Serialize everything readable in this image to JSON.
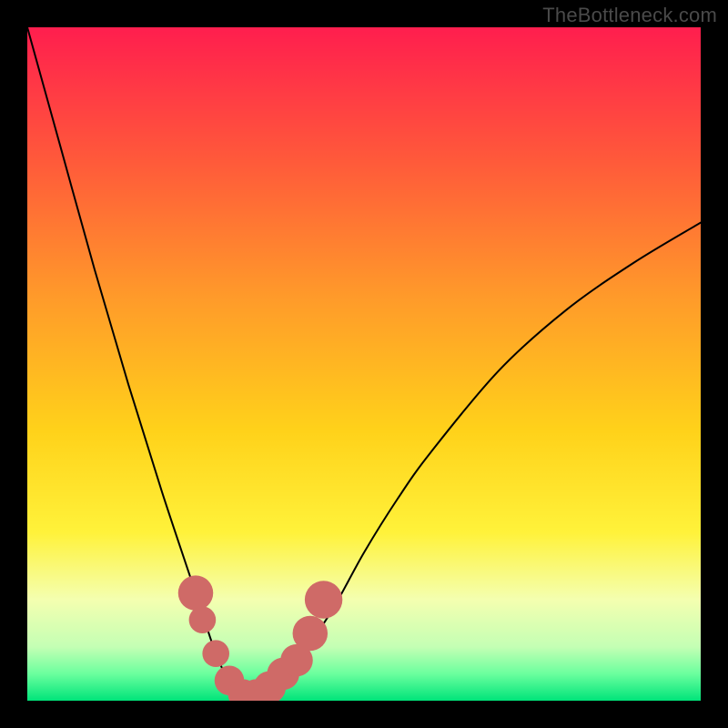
{
  "watermark": "TheBottleneck.com",
  "chart_data": {
    "type": "line",
    "title": "",
    "xlabel": "",
    "ylabel": "",
    "xlim": [
      0,
      100
    ],
    "ylim": [
      0,
      100
    ],
    "series": [
      {
        "name": "bottleneck-curve",
        "x": [
          0,
          5,
          10,
          15,
          20,
          25,
          28,
          30,
          32,
          34,
          36,
          40,
          45,
          50,
          55,
          60,
          70,
          80,
          90,
          100
        ],
        "values": [
          100,
          82,
          64,
          47,
          31,
          16,
          7,
          3,
          1,
          1,
          2,
          6,
          13,
          22,
          30,
          37,
          49,
          58,
          65,
          71
        ]
      }
    ],
    "background_gradient": {
      "stops": [
        {
          "offset": 0.0,
          "color": "#ff1e4e"
        },
        {
          "offset": 0.2,
          "color": "#ff5a3a"
        },
        {
          "offset": 0.4,
          "color": "#ff9a2a"
        },
        {
          "offset": 0.6,
          "color": "#ffd21a"
        },
        {
          "offset": 0.75,
          "color": "#fff23a"
        },
        {
          "offset": 0.85,
          "color": "#f4ffb0"
        },
        {
          "offset": 0.92,
          "color": "#c4ffb4"
        },
        {
          "offset": 0.96,
          "color": "#6bff9e"
        },
        {
          "offset": 1.0,
          "color": "#00e47a"
        }
      ]
    },
    "markers": {
      "name": "highlighted-points",
      "color": "#cf6a67",
      "points": [
        {
          "x": 25,
          "y": 16,
          "r": 2.6
        },
        {
          "x": 26,
          "y": 12,
          "r": 2.0
        },
        {
          "x": 28,
          "y": 7,
          "r": 2.0
        },
        {
          "x": 30,
          "y": 3,
          "r": 2.2
        },
        {
          "x": 32,
          "y": 1,
          "r": 2.2
        },
        {
          "x": 34,
          "y": 1,
          "r": 2.2
        },
        {
          "x": 36,
          "y": 2,
          "r": 2.4
        },
        {
          "x": 38,
          "y": 4,
          "r": 2.4
        },
        {
          "x": 40,
          "y": 6,
          "r": 2.4
        },
        {
          "x": 42,
          "y": 10,
          "r": 2.6
        },
        {
          "x": 44,
          "y": 15,
          "r": 2.8
        }
      ]
    }
  }
}
